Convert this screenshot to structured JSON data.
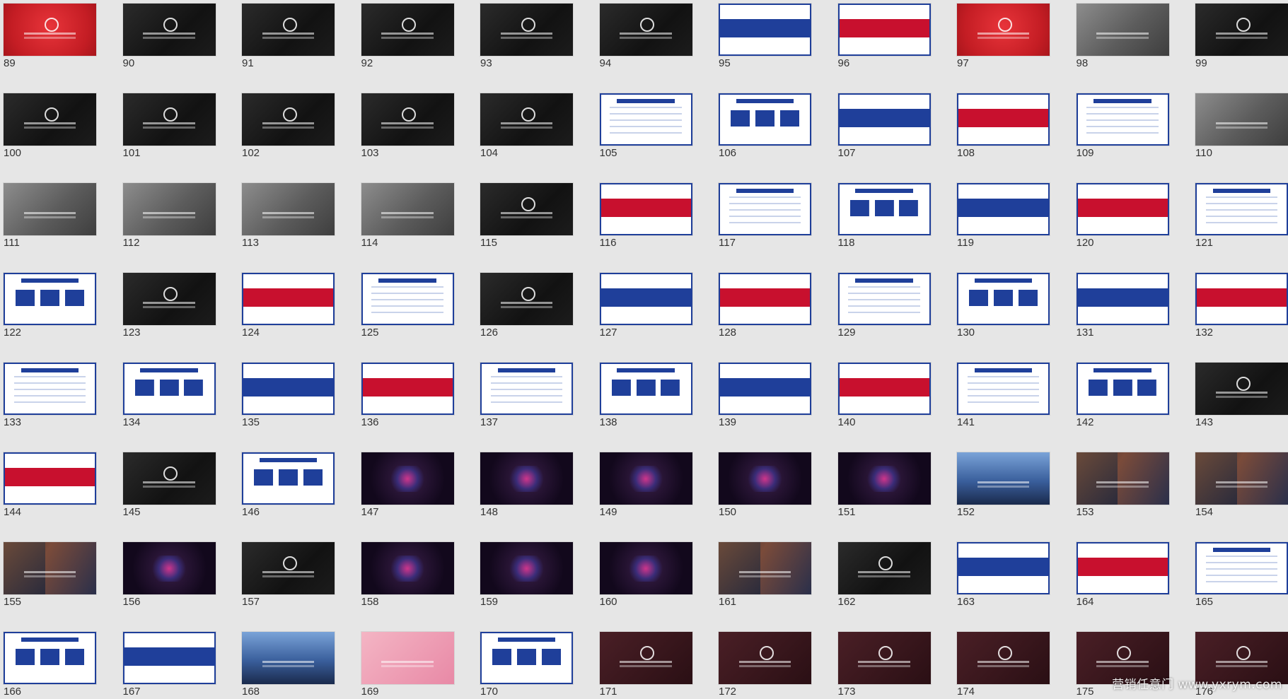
{
  "slides": [
    {
      "n": "89",
      "theme": "red"
    },
    {
      "n": "90",
      "theme": "dark"
    },
    {
      "n": "91",
      "theme": "dark"
    },
    {
      "n": "92",
      "theme": "dark"
    },
    {
      "n": "93",
      "theme": "dark"
    },
    {
      "n": "94",
      "theme": "dark"
    },
    {
      "n": "95",
      "theme": "white"
    },
    {
      "n": "96",
      "theme": "white"
    },
    {
      "n": "97",
      "theme": "red"
    },
    {
      "n": "98",
      "theme": "gray"
    },
    {
      "n": "99",
      "theme": "dark"
    },
    {
      "n": "100",
      "theme": "dark"
    },
    {
      "n": "101",
      "theme": "dark"
    },
    {
      "n": "102",
      "theme": "dark"
    },
    {
      "n": "103",
      "theme": "dark"
    },
    {
      "n": "104",
      "theme": "dark"
    },
    {
      "n": "105",
      "theme": "white"
    },
    {
      "n": "106",
      "theme": "white"
    },
    {
      "n": "107",
      "theme": "white"
    },
    {
      "n": "108",
      "theme": "white"
    },
    {
      "n": "109",
      "theme": "white"
    },
    {
      "n": "110",
      "theme": "gray"
    },
    {
      "n": "111",
      "theme": "gray"
    },
    {
      "n": "112",
      "theme": "gray"
    },
    {
      "n": "113",
      "theme": "gray"
    },
    {
      "n": "114",
      "theme": "gray"
    },
    {
      "n": "115",
      "theme": "dark"
    },
    {
      "n": "116",
      "theme": "white"
    },
    {
      "n": "117",
      "theme": "white"
    },
    {
      "n": "118",
      "theme": "white"
    },
    {
      "n": "119",
      "theme": "white"
    },
    {
      "n": "120",
      "theme": "white"
    },
    {
      "n": "121",
      "theme": "white"
    },
    {
      "n": "122",
      "theme": "white"
    },
    {
      "n": "123",
      "theme": "dark"
    },
    {
      "n": "124",
      "theme": "white"
    },
    {
      "n": "125",
      "theme": "white"
    },
    {
      "n": "126",
      "theme": "dark"
    },
    {
      "n": "127",
      "theme": "white"
    },
    {
      "n": "128",
      "theme": "white"
    },
    {
      "n": "129",
      "theme": "white"
    },
    {
      "n": "130",
      "theme": "white"
    },
    {
      "n": "131",
      "theme": "white"
    },
    {
      "n": "132",
      "theme": "white"
    },
    {
      "n": "133",
      "theme": "white"
    },
    {
      "n": "134",
      "theme": "white"
    },
    {
      "n": "135",
      "theme": "white"
    },
    {
      "n": "136",
      "theme": "white"
    },
    {
      "n": "137",
      "theme": "white"
    },
    {
      "n": "138",
      "theme": "white"
    },
    {
      "n": "139",
      "theme": "white"
    },
    {
      "n": "140",
      "theme": "white"
    },
    {
      "n": "141",
      "theme": "white"
    },
    {
      "n": "142",
      "theme": "white"
    },
    {
      "n": "143",
      "theme": "dark"
    },
    {
      "n": "144",
      "theme": "white"
    },
    {
      "n": "145",
      "theme": "dark"
    },
    {
      "n": "146",
      "theme": "white"
    },
    {
      "n": "147",
      "theme": "neon"
    },
    {
      "n": "148",
      "theme": "neon"
    },
    {
      "n": "149",
      "theme": "neon"
    },
    {
      "n": "150",
      "theme": "neon"
    },
    {
      "n": "151",
      "theme": "neon"
    },
    {
      "n": "152",
      "theme": "sky"
    },
    {
      "n": "153",
      "theme": "photo"
    },
    {
      "n": "154",
      "theme": "photo"
    },
    {
      "n": "155",
      "theme": "photo"
    },
    {
      "n": "156",
      "theme": "neon"
    },
    {
      "n": "157",
      "theme": "dark"
    },
    {
      "n": "158",
      "theme": "neon"
    },
    {
      "n": "159",
      "theme": "neon"
    },
    {
      "n": "160",
      "theme": "neon"
    },
    {
      "n": "161",
      "theme": "photo"
    },
    {
      "n": "162",
      "theme": "dark"
    },
    {
      "n": "163",
      "theme": "white"
    },
    {
      "n": "164",
      "theme": "white"
    },
    {
      "n": "165",
      "theme": "white"
    },
    {
      "n": "166",
      "theme": "white"
    },
    {
      "n": "167",
      "theme": "white"
    },
    {
      "n": "168",
      "theme": "sky"
    },
    {
      "n": "169",
      "theme": "pink"
    },
    {
      "n": "170",
      "theme": "white"
    },
    {
      "n": "171",
      "theme": "maroon"
    },
    {
      "n": "172",
      "theme": "maroon"
    },
    {
      "n": "173",
      "theme": "maroon"
    },
    {
      "n": "174",
      "theme": "maroon"
    },
    {
      "n": "175",
      "theme": "maroon"
    },
    {
      "n": "176",
      "theme": "maroon"
    }
  ],
  "watermark": "营销任意门 www.yxrym.com",
  "colors": {
    "background": "#e6e6e6",
    "accent_blue": "#1f3f9a",
    "accent_red": "#c8102e"
  }
}
